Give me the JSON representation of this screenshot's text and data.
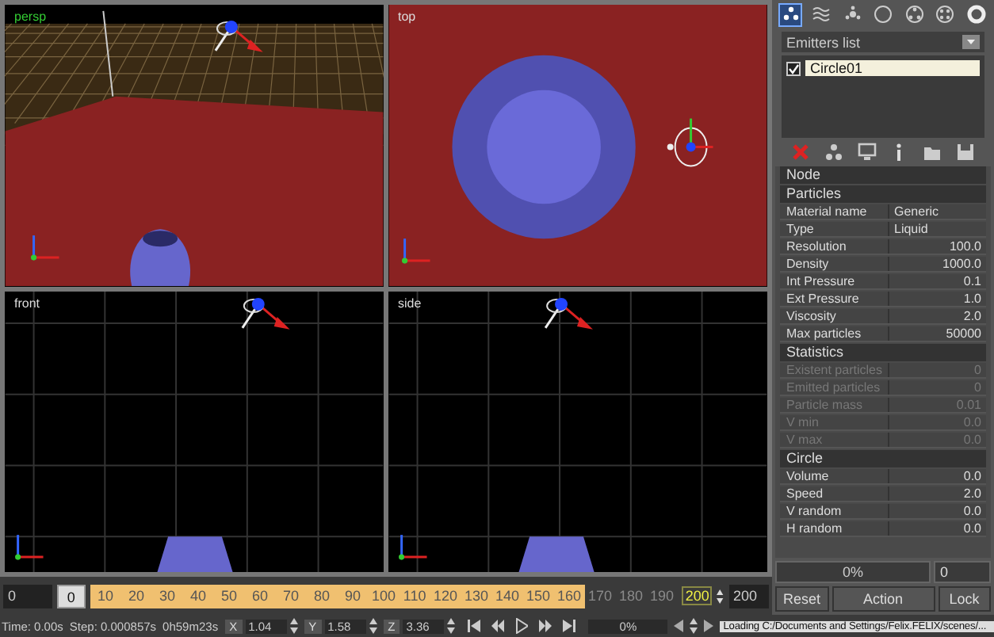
{
  "viewports": [
    {
      "label": "persp",
      "kind": "persp"
    },
    {
      "label": "top",
      "kind": "top"
    },
    {
      "label": "front",
      "kind": "front"
    },
    {
      "label": "side",
      "kind": "side"
    }
  ],
  "panel_tabs": [
    {
      "selected": true
    },
    {
      "selected": false
    },
    {
      "selected": false
    },
    {
      "selected": false
    },
    {
      "selected": false
    },
    {
      "selected": false
    },
    {
      "selected": false
    }
  ],
  "emitters": {
    "header": "Emitters list",
    "items": [
      {
        "label": "Circle01",
        "checked": true,
        "selected": true
      }
    ]
  },
  "sections": [
    {
      "title": "Node"
    },
    {
      "title": "Particles",
      "rows": [
        {
          "name": "Material name",
          "value": "Generic",
          "kind": "text",
          "disabled": false
        },
        {
          "name": "Type",
          "value": "Liquid",
          "kind": "text",
          "disabled": false
        },
        {
          "name": "Resolution",
          "value": "100.0",
          "kind": "number",
          "disabled": false
        },
        {
          "name": "Density",
          "value": "1000.0",
          "kind": "number",
          "disabled": false
        },
        {
          "name": "Int Pressure",
          "value": "0.1",
          "kind": "number",
          "disabled": false
        },
        {
          "name": "Ext Pressure",
          "value": "1.0",
          "kind": "number",
          "disabled": false
        },
        {
          "name": "Viscosity",
          "value": "2.0",
          "kind": "number",
          "disabled": false
        },
        {
          "name": "Max particles",
          "value": "50000",
          "kind": "number",
          "disabled": false
        }
      ]
    },
    {
      "title": "Statistics",
      "rows": [
        {
          "name": "Existent particles",
          "value": "0",
          "kind": "number",
          "disabled": true
        },
        {
          "name": "Emitted particles",
          "value": "0",
          "kind": "number",
          "disabled": true
        },
        {
          "name": "Particle mass",
          "value": "0.01",
          "kind": "number",
          "disabled": true
        },
        {
          "name": "V min",
          "value": "0.0",
          "kind": "number",
          "disabled": true
        },
        {
          "name": "V max",
          "value": "0.0",
          "kind": "number",
          "disabled": true
        }
      ]
    },
    {
      "title": "Circle",
      "rows": [
        {
          "name": "Volume",
          "value": "0.0",
          "kind": "number",
          "disabled": false
        },
        {
          "name": "Speed",
          "value": "2.0",
          "kind": "number",
          "disabled": false
        },
        {
          "name": "V random",
          "value": "0.0",
          "kind": "number",
          "disabled": false
        },
        {
          "name": "H random",
          "value": "0.0",
          "kind": "number",
          "disabled": false
        }
      ]
    }
  ],
  "progress": {
    "label": "0%",
    "level": 0,
    "count": "0"
  },
  "panel_buttons": [
    "Reset",
    "Action",
    "Lock"
  ],
  "timeline": {
    "start": "0",
    "current": "0",
    "ticks": [
      {
        "label": "10",
        "in_range": true
      },
      {
        "label": "20",
        "in_range": true
      },
      {
        "label": "30",
        "in_range": true
      },
      {
        "label": "40",
        "in_range": true
      },
      {
        "label": "50",
        "in_range": true
      },
      {
        "label": "60",
        "in_range": true
      },
      {
        "label": "70",
        "in_range": true
      },
      {
        "label": "80",
        "in_range": true
      },
      {
        "label": "90",
        "in_range": true
      },
      {
        "label": "100",
        "in_range": true
      },
      {
        "label": "110",
        "in_range": true
      },
      {
        "label": "120",
        "in_range": true
      },
      {
        "label": "130",
        "in_range": true
      },
      {
        "label": "140",
        "in_range": true
      },
      {
        "label": "150",
        "in_range": true
      },
      {
        "label": "160",
        "in_range": true
      },
      {
        "label": "170",
        "in_range": false
      },
      {
        "label": "180",
        "in_range": false
      },
      {
        "label": "190",
        "in_range": false
      }
    ],
    "end_marker": "200",
    "end": "200"
  },
  "status_bar": {
    "time": "Time: 0.00s",
    "step": "Step: 0.000857s",
    "elapsed": "0h59m23s",
    "coords": [
      {
        "axis": "X",
        "value": "1.04"
      },
      {
        "axis": "Y",
        "value": "1.58"
      },
      {
        "axis": "Z",
        "value": "3.36"
      }
    ],
    "progress": "0%",
    "message": "Loading C:/Documents and Settings/Felix.FELIX/scenes/..."
  }
}
